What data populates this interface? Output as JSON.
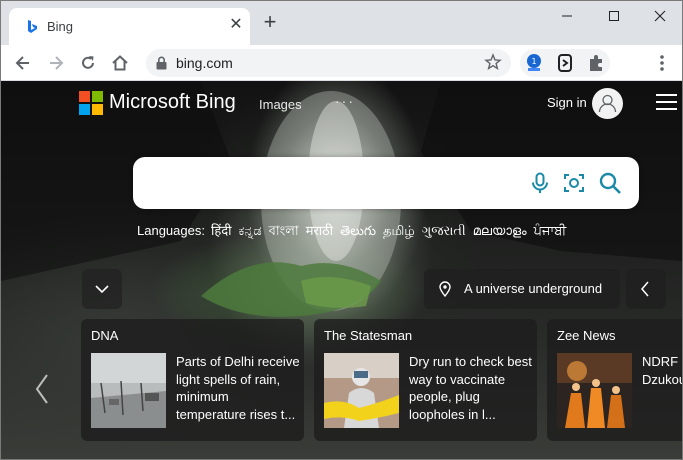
{
  "browser": {
    "tab_title": "Bing",
    "url": "bing.com"
  },
  "header": {
    "brand": "Microsoft Bing",
    "nav_images": "Images",
    "nav_more": "···",
    "sign_in": "Sign in"
  },
  "search": {
    "placeholder": ""
  },
  "languages": {
    "label": "Languages:",
    "items": [
      "हिंदी",
      "ಕನ್ನಡ",
      "বাংলা",
      "मराठी",
      "తెలుగు",
      "தமிழ்",
      "ગુજરાતી",
      "മലയാളം",
      "ਪੰਜਾਬੀ"
    ]
  },
  "image_caption": "A universe underground",
  "news": [
    {
      "source": "DNA",
      "headline": "Parts of Delhi receive light spells of rain, minimum temperature rises t..."
    },
    {
      "source": "The Statesman",
      "headline": "Dry run to check best way to vaccinate people, plug loopholes in l..."
    },
    {
      "source": "Zee News",
      "headline": "NDRF c teams, Dzukou wildfire"
    }
  ],
  "colors": {
    "ms_red": "#f25022",
    "ms_green": "#7fba00",
    "ms_blue": "#00a4ef",
    "ms_yellow": "#ffb900",
    "bing_teal": "#1a8aa8"
  }
}
